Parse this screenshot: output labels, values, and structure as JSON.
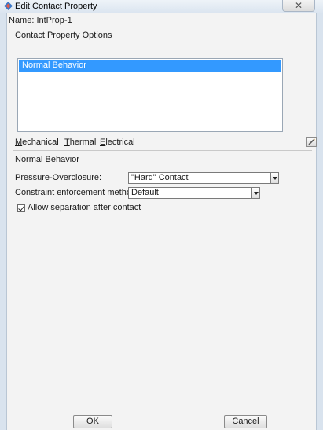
{
  "window": {
    "title": "Edit Contact Property",
    "close_glyph": "✕"
  },
  "name_label": "Name: IntProp-1",
  "options_label": "Contact Property Options",
  "options_list": [
    {
      "label": "Normal Behavior",
      "selected": true
    }
  ],
  "tabs": [
    {
      "underline": "M",
      "rest": "echanical"
    },
    {
      "underline": "T",
      "rest": "hermal"
    },
    {
      "underline": "E",
      "rest": "lectrical"
    }
  ],
  "section_title": "Normal Behavior",
  "pressure": {
    "label": "Pressure-Overclosure:",
    "value": "\"Hard\" Contact"
  },
  "constraint": {
    "label": "Constraint enforcement method:",
    "value": "Default"
  },
  "separation": {
    "label": "Allow separation after contact",
    "checked": true
  },
  "buttons": {
    "ok": "OK",
    "cancel": "Cancel"
  },
  "colors": {
    "selection": "#3399ff",
    "window_frame": "#d9e3ee"
  },
  "icons": {
    "title": "abaqus-app-icon",
    "edit": "edit-pencil-icon"
  }
}
